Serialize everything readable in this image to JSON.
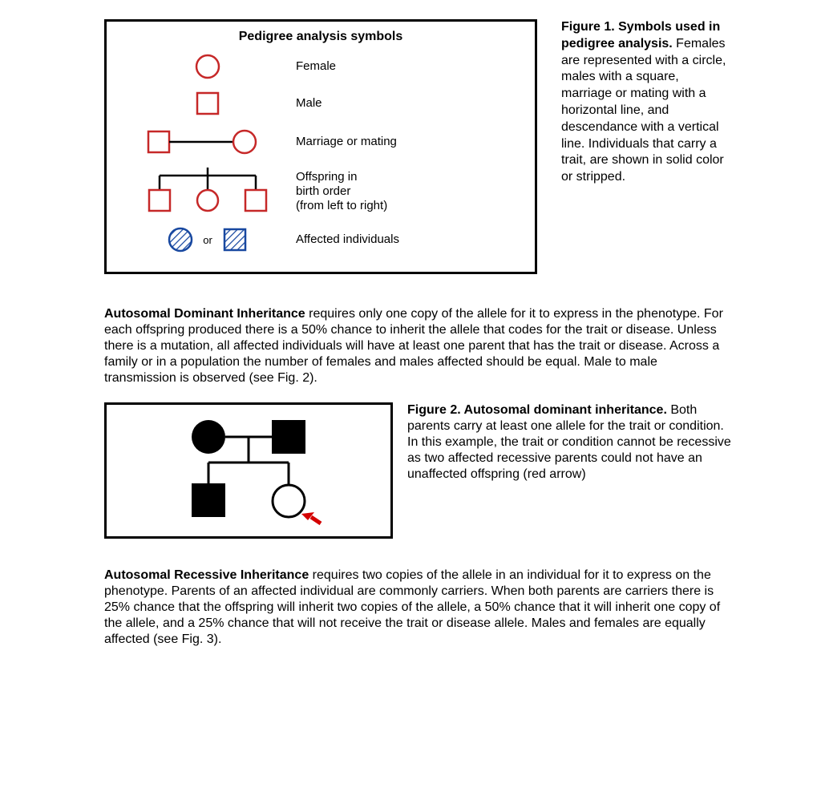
{
  "figure1": {
    "box_title": "Pedigree analysis symbols",
    "rows": {
      "female": "Female",
      "male": "Male",
      "marriage": "Marriage or mating",
      "offspring": "Offspring in\nbirth order\n(from left to right)",
      "affected": "Affected individuals",
      "or": "or"
    },
    "caption_bold": "Figure 1. Symbols used in pedigree analysis.",
    "caption_rest": " Females are represented with a circle, males with a square, marriage or mating with a horizontal line, and descendance with a vertical line. Individuals that carry a trait, are shown in solid color or stripped."
  },
  "para1": {
    "bold": "Autosomal Dominant Inheritance",
    "rest": " requires only one copy of the allele for it to express in the phenotype. For each offspring produced there is a 50% chance to inherit the allele that codes for the trait or disease. Unless there is a mutation, all affected individuals will have at least one parent that has the trait or disease. Across a family or in a population the number of females and males affected should be equal. Male to male transmission is observed (see Fig. 2)."
  },
  "figure2": {
    "caption_bold": "Figure 2. Autosomal dominant inheritance.",
    "caption_rest": " Both parents carry at least one allele for the trait or condition. In this example, the trait or condition cannot be recessive as two affected recessive parents could not have an unaffected offspring (red arrow)"
  },
  "para2": {
    "bold": "Autosomal Recessive Inheritance",
    "rest": " requires two copies of the allele in an individual for it to express on the phenotype. Parents of an affected individual are commonly carriers. When both parents are carriers there is 25% chance that the offspring will inherit two copies of the allele, a 50% chance that it will inherit one copy of the allele, and a 25% chance that will not receive the trait or disease allele.  Males and females are equally affected (see Fig. 3)."
  }
}
